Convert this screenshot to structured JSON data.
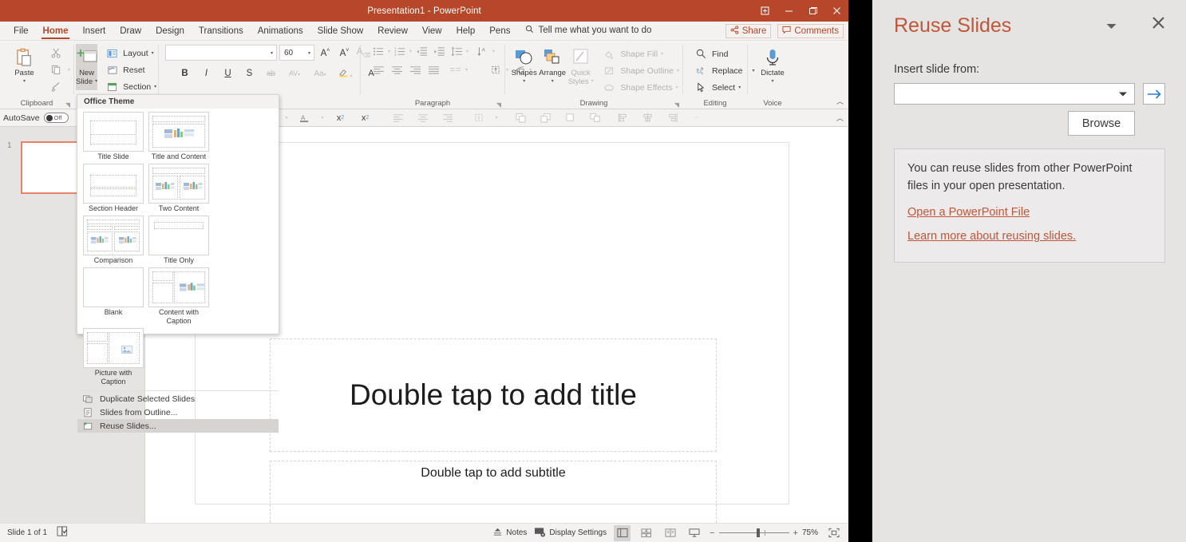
{
  "window": {
    "title": "Presentation1  -  PowerPoint",
    "buttons": {
      "restore_icon": "restore-down-icon",
      "minimize": "–",
      "maximize": "maximize-icon",
      "close": "✕"
    }
  },
  "ribbon": {
    "tabs": [
      {
        "label": "File",
        "active": false
      },
      {
        "label": "Home",
        "active": true
      },
      {
        "label": "Insert",
        "active": false
      },
      {
        "label": "Draw",
        "active": false
      },
      {
        "label": "Design",
        "active": false
      },
      {
        "label": "Transitions",
        "active": false
      },
      {
        "label": "Animations",
        "active": false
      },
      {
        "label": "Slide Show",
        "active": false
      },
      {
        "label": "Review",
        "active": false
      },
      {
        "label": "View",
        "active": false
      },
      {
        "label": "Help",
        "active": false
      },
      {
        "label": "Pens",
        "active": false
      }
    ],
    "tell_me": "Tell me what you want to do",
    "share": "Share",
    "comments": "Comments",
    "groups": {
      "clipboard": {
        "label": "Clipboard",
        "paste": "Paste",
        "cut_icon": "scissors-icon",
        "copy_icon": "copy-icon",
        "format_painter_icon": "format-painter-icon"
      },
      "slides": {
        "label": "Office Theme",
        "new_slide": "New\nSlide",
        "new_slide_line1": "New",
        "new_slide_line2": "Slide",
        "layout": "Layout",
        "reset": "Reset",
        "section": "Section"
      },
      "font": {
        "font_name": "",
        "font_size": "60",
        "grow": "A",
        "shrink": "A",
        "clear": "A",
        "bold": "B",
        "italic": "I",
        "underline": "U",
        "shadow": "S",
        "strike": "ab",
        "spacing": "AV",
        "case": "Aa",
        "highlight_icon": "text-highlight-icon",
        "color_icon": "font-color-icon"
      },
      "paragraph": {
        "label": "Paragraph"
      },
      "drawing": {
        "label": "Drawing",
        "shapes": "Shapes",
        "arrange": "Arrange",
        "quick_styles_line1": "Quick",
        "quick_styles_line2": "Styles",
        "shape_fill": "Shape Fill",
        "shape_outline": "Shape Outline",
        "shape_effects": "Shape Effects"
      },
      "editing": {
        "label": "Editing",
        "find": "Find",
        "replace": "Replace",
        "select": "Select"
      },
      "voice": {
        "label": "Voice",
        "dictate": "Dictate"
      }
    }
  },
  "quick_row": {
    "autosave_label": "AutoSave",
    "autosave_state": "Off",
    "subscript": "x",
    "superscript": "x"
  },
  "gallery": {
    "header": "Office Theme",
    "layouts": [
      {
        "name": "Title Slide",
        "kind": "title"
      },
      {
        "name": "Title and Content",
        "kind": "title-content"
      },
      {
        "name": "Section Header",
        "kind": "section"
      },
      {
        "name": "Two Content",
        "kind": "two-content"
      },
      {
        "name": "Comparison",
        "kind": "comparison"
      },
      {
        "name": "Title Only",
        "kind": "title-only"
      },
      {
        "name": "Blank",
        "kind": "blank"
      },
      {
        "name": "Content with Caption",
        "kind": "content-caption"
      },
      {
        "name": "Picture with Caption",
        "kind": "picture-caption"
      }
    ],
    "menu": [
      {
        "label": "Duplicate Selected Slides",
        "icon": "duplicate-slides-icon",
        "highlighted": false,
        "underline_first": true
      },
      {
        "label": "Slides from Outline...",
        "icon": "outline-icon",
        "highlighted": false,
        "underline_first": false
      },
      {
        "label": "Reuse Slides...",
        "icon": "reuse-slides-icon",
        "highlighted": true,
        "underline_first": false
      }
    ]
  },
  "slide": {
    "thumb_number": "1",
    "title_placeholder": "Double tap to add title",
    "subtitle_placeholder": "Double tap to add subtitle"
  },
  "status": {
    "slide_count": "Slide 1 of 1",
    "accessibility_icon": "accessibility-checker-icon",
    "notes": "Notes",
    "display_settings": "Display Settings",
    "zoom": "75%",
    "zoom_minus": "−",
    "zoom_plus": "+"
  },
  "panel": {
    "title": "Reuse Slides",
    "caret_icon": "chevron-down-icon",
    "close_icon": "close-icon",
    "insert_label": "Insert slide from:",
    "combo_value": "",
    "go_icon": "arrow-right-icon",
    "browse": "Browse",
    "info_text": "You can reuse slides from other PowerPoint files in your open presentation.",
    "link_open": "Open a PowerPoint File",
    "link_learn": "Learn more about reusing slides."
  },
  "colors": {
    "accent": "#b7472a",
    "panel_title": "#c0563a",
    "selection": "#e8836a"
  }
}
